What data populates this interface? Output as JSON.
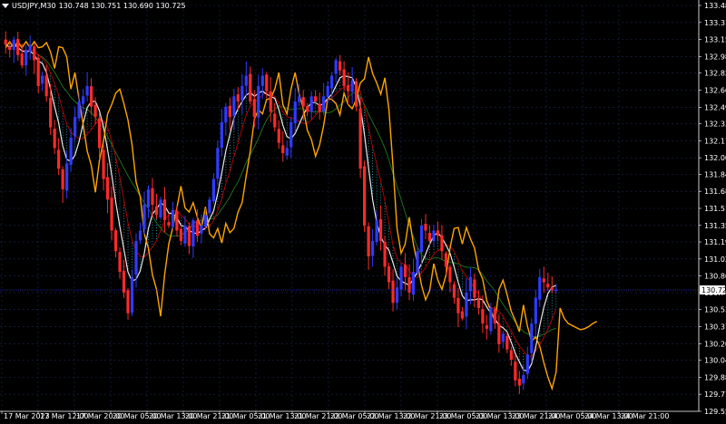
{
  "window": {
    "symbol_label": "USDJPY,M30",
    "ohlc": "130.748 130.751 130.690 130.725",
    "menu_icon": "triangle-down-icon"
  },
  "colors": {
    "background": "#000000",
    "grid": "#1d2a55",
    "axis_text": "#ffffff",
    "bull_candle": "#2f3bff",
    "bear_candle": "#ff2a2a",
    "price_line": "#2f3bff",
    "price_label_bg": "#ffffff",
    "orange_line": "#ffa500",
    "white_line": "#e8e8e8",
    "red_ma": "#c00000",
    "green_ma": "#1e7a1e",
    "cloud_dots": "#2ec4d4"
  },
  "chart_data": {
    "type": "candlestick",
    "current_price": 130.725,
    "y_ticks": [
      "133.480",
      "133.315",
      "133.150",
      "132.985",
      "132.825",
      "132.660",
      "132.495",
      "132.335",
      "132.170",
      "132.005",
      "131.845",
      "131.680",
      "131.515",
      "131.350",
      "131.190",
      "131.025",
      "130.860",
      "130.700",
      "130.535",
      "130.370",
      "130.205",
      "130.045",
      "129.880",
      "129.715",
      "129.550"
    ],
    "ylim": [
      129.55,
      133.48
    ],
    "x_ticks": [
      "17 Mar 2023",
      "17 Mar 12:00",
      "17 Mar 20:00",
      "20 Mar 05:00",
      "20 Mar 13:00",
      "20 Mar 21:00",
      "21 Mar 05:00",
      "21 Mar 13:00",
      "21 Mar 21:00",
      "22 Mar 05:00",
      "22 Mar 13:00",
      "22 Mar 21:00",
      "23 Mar 05:00",
      "23 Mar 13:00",
      "23 Mar 21:00",
      "24 Mar 05:00",
      "24 Mar 13:00",
      "24 Mar 21:00"
    ],
    "close": [
      133.1,
      133.05,
      133.15,
      133.0,
      132.9,
      133.05,
      133.1,
      132.95,
      132.7,
      132.8,
      132.6,
      132.3,
      132.1,
      131.9,
      131.7,
      131.95,
      132.2,
      132.4,
      132.55,
      132.6,
      132.7,
      132.5,
      132.4,
      132.1,
      131.8,
      131.6,
      131.3,
      131.1,
      130.9,
      130.7,
      130.5,
      130.85,
      131.2,
      131.3,
      131.55,
      131.7,
      131.55,
      131.45,
      131.6,
      131.4,
      131.35,
      131.5,
      131.3,
      131.2,
      131.35,
      131.15,
      131.4,
      131.25,
      131.35,
      131.45,
      131.6,
      131.8,
      132.1,
      132.35,
      132.5,
      132.4,
      132.6,
      132.55,
      132.7,
      132.8,
      132.55,
      132.4,
      132.7,
      132.8,
      132.65,
      132.45,
      132.3,
      132.15,
      132.05,
      132.1,
      132.35,
      132.55,
      132.6,
      132.5,
      132.45,
      132.6,
      132.55,
      132.45,
      132.6,
      132.7,
      132.8,
      132.95,
      132.85,
      132.7,
      132.65,
      132.75,
      132.5,
      131.9,
      131.35,
      131.05,
      131.2,
      131.4,
      131.2,
      130.95,
      130.8,
      130.6,
      130.75,
      130.95,
      130.85,
      130.7,
      130.9,
      131.1,
      131.35,
      131.3,
      131.2,
      131.3,
      131.25,
      131.1,
      130.95,
      130.8,
      130.65,
      130.5,
      130.45,
      130.7,
      130.85,
      130.65,
      130.55,
      130.4,
      130.35,
      130.55,
      130.4,
      130.2,
      130.3,
      130.15,
      130.05,
      129.85,
      129.8,
      129.9,
      130.1,
      130.4,
      130.65,
      130.85,
      130.8,
      130.75,
      130.72,
      130.73
    ],
    "orange_extension": [
      130.55,
      130.45,
      130.4,
      130.38,
      130.36,
      130.34,
      130.35,
      130.37,
      130.4,
      130.42
    ]
  }
}
